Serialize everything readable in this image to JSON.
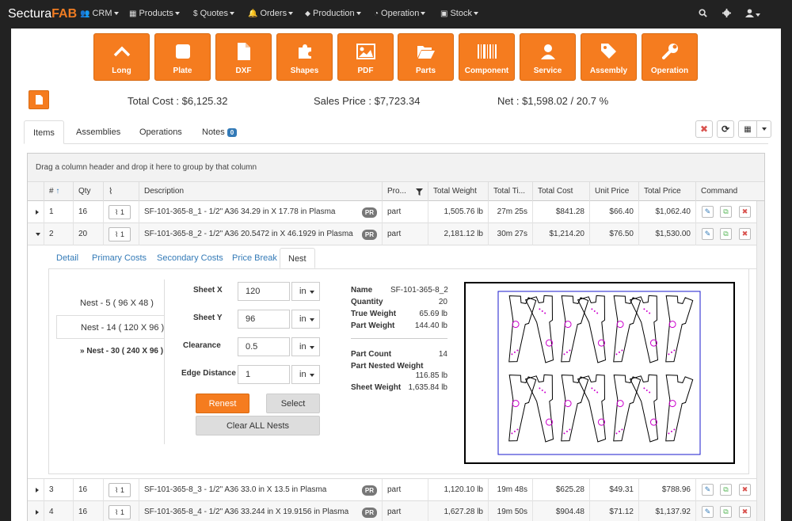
{
  "brand": {
    "part1": "Sectura",
    "part2": "FAB"
  },
  "nav": [
    {
      "icon": "users-icon",
      "glyph": "👥",
      "label": "CRM"
    },
    {
      "icon": "table-icon",
      "glyph": "▦",
      "label": "Products"
    },
    {
      "icon": "dollar-icon",
      "glyph": "$",
      "label": "Quotes"
    },
    {
      "icon": "bell-icon",
      "glyph": "🔔",
      "label": "Orders"
    },
    {
      "icon": "tag-icon",
      "glyph": "⬥",
      "label": "Production"
    },
    {
      "icon": "gauge-icon",
      "glyph": "◔",
      "label": "Operation"
    },
    {
      "icon": "box-icon",
      "glyph": "▣",
      "label": "Stock"
    }
  ],
  "tiles": [
    "Long",
    "Plate",
    "DXF",
    "Shapes",
    "PDF",
    "Parts",
    "Component",
    "Service",
    "Assembly",
    "Operation"
  ],
  "summary": {
    "total_cost": "Total Cost : $6,125.32",
    "sales_price": "Sales Price : $7,723.34",
    "net": "Net : $1,598.02 / 20.7 %"
  },
  "tabs": {
    "items": "Items",
    "assemblies": "Assemblies",
    "operations": "Operations",
    "notes": "Notes",
    "notes_count": "0"
  },
  "grid": {
    "group_hint": "Drag a column header and drop it here to group by that column",
    "headers": {
      "num": "#",
      "qty": "Qty",
      "desc": "Description",
      "pro": "Pro...",
      "weight": "Total Weight",
      "time": "Total Ti...",
      "cost": "Total Cost",
      "unit": "Unit Price",
      "price": "Total Price",
      "command": "Command"
    },
    "rows": [
      {
        "num": "1",
        "qty": "16",
        "clip": "1",
        "desc": "SF-101-365-8_1 - 1/2\" A36 34.29 in X 17.78 in Plasma",
        "badge": "PR",
        "type": "part",
        "weight": "1,505.76 lb",
        "time": "27m 25s",
        "cost": "$841.28",
        "unit": "$66.40",
        "price": "$1,062.40"
      },
      {
        "num": "2",
        "qty": "20",
        "clip": "1",
        "desc": "SF-101-365-8_2 - 1/2\" A36 20.5472 in X 46.1929 in Plasma",
        "badge": "PR",
        "type": "part",
        "weight": "2,181.12 lb",
        "time": "30m 27s",
        "cost": "$1,214.20",
        "unit": "$76.50",
        "price": "$1,530.00"
      },
      {
        "num": "3",
        "qty": "16",
        "clip": "1",
        "desc": "SF-101-365-8_3 - 1/2\" A36 33.0 in X 13.5 in Plasma",
        "badge": "PR",
        "type": "part",
        "weight": "1,120.10 lb",
        "time": "19m 48s",
        "cost": "$625.28",
        "unit": "$49.31",
        "price": "$788.96"
      },
      {
        "num": "4",
        "qty": "16",
        "clip": "1",
        "desc": "SF-101-365-8_4 - 1/2\" A36 33.244 in X 19.9156 in Plasma",
        "badge": "PR",
        "type": "part",
        "weight": "1,627.28 lb",
        "time": "19m 50s",
        "cost": "$904.48",
        "unit": "$71.12",
        "price": "$1,137.92"
      }
    ]
  },
  "detail": {
    "tabs": [
      "Detail",
      "Primary Costs",
      "Secondary Costs",
      "Price Break",
      "Nest"
    ],
    "nests": [
      "Nest - 5 ( 96 X 48 )",
      "Nest - 14 ( 120 X 96 )",
      "» Nest - 30 ( 240 X 96 )"
    ],
    "form": {
      "sheet_x_label": "Sheet X",
      "sheet_x": "120",
      "sheet_y_label": "Sheet Y",
      "sheet_y": "96",
      "clearance_label": "Clearance",
      "clearance": "0.5",
      "edge_label": "Edge Distance",
      "edge": "1",
      "unit": "in"
    },
    "buttons": {
      "renest": "Renest",
      "select": "Select",
      "clear": "Clear ALL Nests"
    },
    "info": {
      "name_label": "Name",
      "name": "SF-101-365-8_2",
      "qty_label": "Quantity",
      "qty": "20",
      "true_weight_label": "True Weight",
      "true_weight": "65.69 lb",
      "part_weight_label": "Part Weight",
      "part_weight": "144.40 lb",
      "count_label": "Part Count",
      "count": "14",
      "nested_label": "Part Nested Weight",
      "nested": "116.85 lb",
      "sheet_label": "Sheet Weight",
      "sheet": "1,635.84 lb"
    }
  },
  "colors": {
    "accent": "#f57c1f",
    "nav_bg": "#222222",
    "link": "#337ab7",
    "danger": "#d9534f",
    "magenta": "#cc00cc",
    "sheet_blue": "#1a1acc"
  }
}
